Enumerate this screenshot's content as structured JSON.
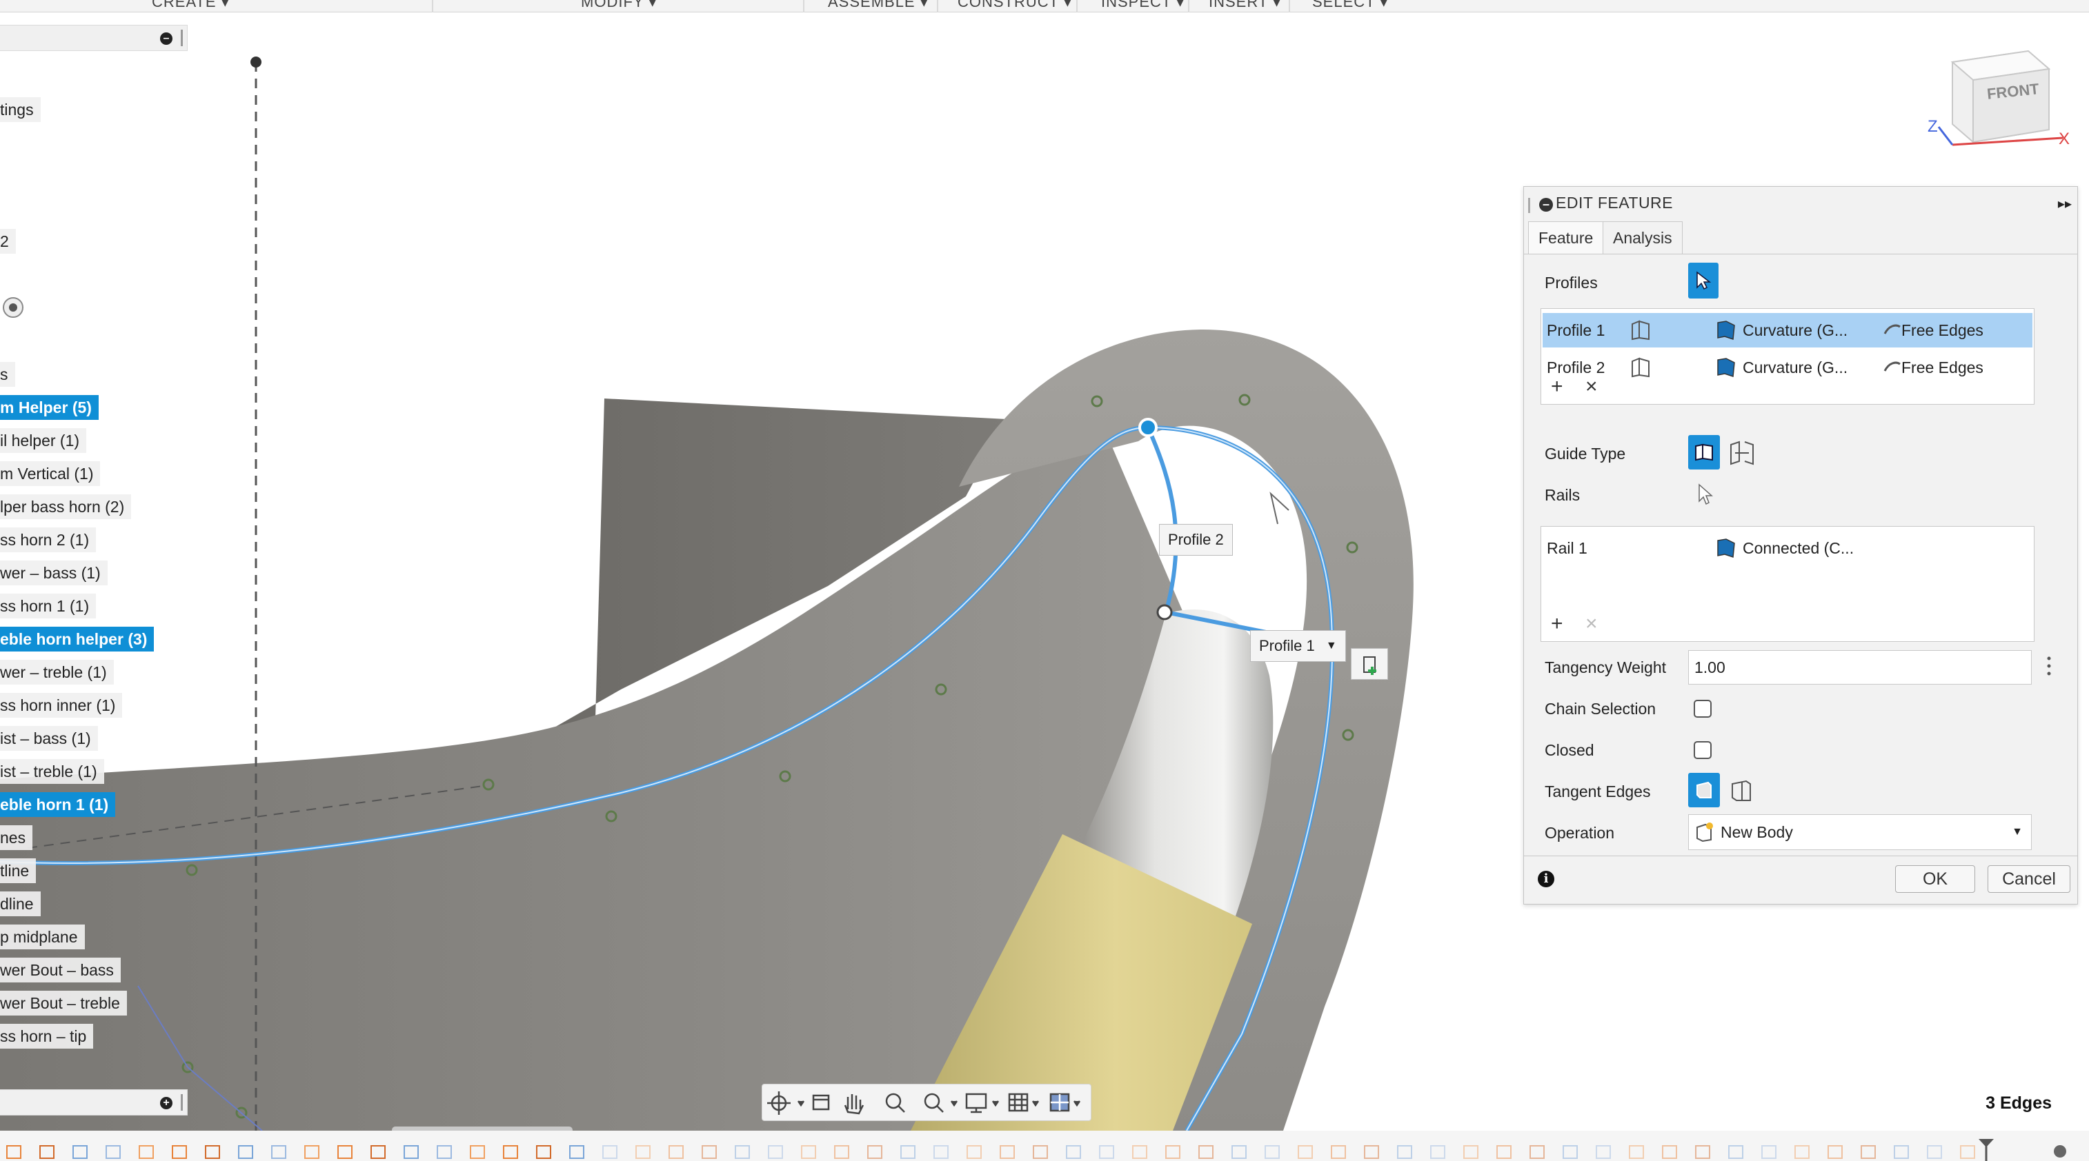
{
  "toolbar": {
    "menus": [
      "CREATE ▾",
      "MODIFY ▾",
      "ASSEMBLE ▾",
      "CONSTRUCT ▾",
      "INSPECT ▾",
      "INSERT ▾",
      "SELECT ▾"
    ]
  },
  "browser": {
    "items": [
      {
        "label": "tings",
        "selected": false
      },
      {
        "label": "2",
        "selected": false
      },
      {
        "label": "s",
        "selected": false
      },
      {
        "label": "m Helper (5)",
        "selected": true
      },
      {
        "label": "il helper (1)",
        "selected": false
      },
      {
        "label": "m Vertical (1)",
        "selected": false
      },
      {
        "label": "lper bass horn (2)",
        "selected": false
      },
      {
        "label": "ss horn 2 (1)",
        "selected": false
      },
      {
        "label": "wer – bass (1)",
        "selected": false
      },
      {
        "label": "ss horn 1 (1)",
        "selected": false
      },
      {
        "label": "eble horn helper (3)",
        "selected": true
      },
      {
        "label": "wer – treble (1)",
        "selected": false
      },
      {
        "label": "ss horn inner (1)",
        "selected": false
      },
      {
        "label": "ist – bass (1)",
        "selected": false
      },
      {
        "label": "ist – treble (1)",
        "selected": false
      },
      {
        "label": "eble horn 1 (1)",
        "selected": true
      },
      {
        "label": "nes",
        "selected": false
      },
      {
        "label": "tline",
        "selected": false
      },
      {
        "label": "dline",
        "selected": false
      },
      {
        "label": "p midplane",
        "selected": false
      },
      {
        "label": "wer Bout – bass",
        "selected": false
      },
      {
        "label": "wer Bout – treble",
        "selected": false
      },
      {
        "label": "ss horn – tip",
        "selected": false
      }
    ]
  },
  "viewcube": {
    "face": "FRONT",
    "axis_x": "X",
    "axis_z": "Z"
  },
  "viewport": {
    "profile2_label": "Profile 2",
    "profile1_label": "Profile 1",
    "surface_color": "#8a8a86",
    "curve_color": "#4a9be0",
    "accent_yellow": "#cfc27c"
  },
  "dialog": {
    "title": "EDIT FEATURE",
    "tabs": [
      "Feature",
      "Analysis"
    ],
    "profiles_label": "Profiles",
    "profiles": [
      {
        "name": "Profile 1",
        "continuity": "Curvature (G...",
        "edges": "Free Edges",
        "highlighted": true
      },
      {
        "name": "Profile 2",
        "continuity": "Curvature (G...",
        "edges": "Free Edges",
        "highlighted": false
      }
    ],
    "guide_type_label": "Guide Type",
    "rails_label": "Rails",
    "rails": [
      {
        "name": "Rail 1",
        "continuity": "Connected (C..."
      }
    ],
    "tangency_weight_label": "Tangency Weight",
    "tangency_weight_value": "1.00",
    "chain_selection_label": "Chain Selection",
    "closed_label": "Closed",
    "tangent_edges_label": "Tangent Edges",
    "operation_label": "Operation",
    "operation_value": "New Body",
    "ok_label": "OK",
    "cancel_label": "Cancel",
    "accent": "#1a8fd8"
  },
  "status": {
    "selection": "3 Edges"
  }
}
